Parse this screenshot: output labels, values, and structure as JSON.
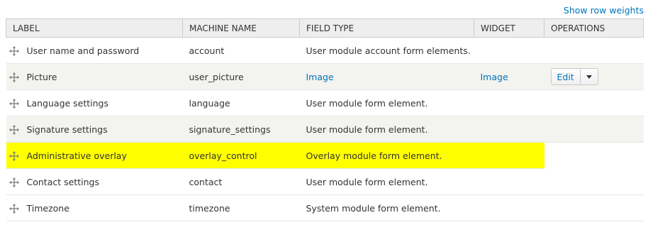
{
  "header": {
    "show_row_weights": "Show row weights"
  },
  "columns": [
    "Label",
    "Machine name",
    "Field type",
    "Widget",
    "Operations"
  ],
  "rows": [
    {
      "label": "User name and password",
      "machine": "account",
      "type": "User module account form elements.",
      "widget": "",
      "operations": ""
    },
    {
      "label": "Picture",
      "machine": "user_picture",
      "type": "Image",
      "widget": "Image",
      "operations": "Edit"
    },
    {
      "label": "Language settings",
      "machine": "language",
      "type": "User module form element.",
      "widget": "",
      "operations": ""
    },
    {
      "label": "Signature settings",
      "machine": "signature_settings",
      "type": "User module form element.",
      "widget": "",
      "operations": ""
    },
    {
      "label": "Administrative overlay",
      "machine": "overlay_control",
      "type": "Overlay module form element.",
      "widget": "",
      "operations": ""
    },
    {
      "label": "Contact settings",
      "machine": "contact",
      "type": "User module form element.",
      "widget": "",
      "operations": ""
    },
    {
      "label": "Timezone",
      "machine": "timezone",
      "type": "System module form element.",
      "widget": "",
      "operations": ""
    }
  ],
  "highlight_color": "#ffff00",
  "link_color": "#0074bd",
  "icons": {
    "drag": "drag-handle-icon",
    "dropdown": "chevron-down-icon"
  }
}
